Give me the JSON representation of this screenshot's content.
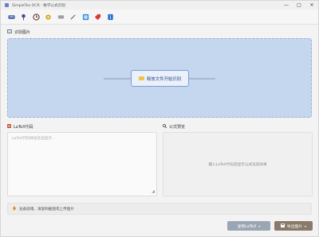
{
  "window": {
    "title": "SimpleTex OCR - 数学公式识别",
    "controls": {
      "minimize": "—",
      "maximize": "□",
      "close": "✕"
    }
  },
  "toolbar": {
    "tools": [
      {
        "icon": "keyboard-icon",
        "color": "#3b5aa8"
      },
      {
        "icon": "pin-icon",
        "color": "#4a4a8a"
      },
      {
        "icon": "history-icon",
        "color": "#6a3b3b"
      },
      {
        "icon": "settings-icon",
        "color": "#e0a32b"
      },
      {
        "icon": "text-icon",
        "color": "#555555"
      },
      {
        "icon": "pen-icon",
        "color": "#777777"
      },
      {
        "icon": "image-icon",
        "color": "#2b8ad8"
      },
      {
        "icon": "tag-icon",
        "color": "#d83b3b"
      },
      {
        "icon": "info-icon",
        "color": "#2b6ad8"
      }
    ]
  },
  "image_panel": {
    "label": "识别图片",
    "drop_button": "释放文件开始识别"
  },
  "latex_panel": {
    "label": "LaTeX代码",
    "placeholder": "LaTeX代码将会在此显示..."
  },
  "preview_panel": {
    "label": "公式预览",
    "placeholder": "输入LaTeX代码后显示公式渲染效果"
  },
  "status": {
    "text": "准备就绪，请复制截图或上传图片"
  },
  "buttons": {
    "copy_latex": "复制LaTeX",
    "export_image": "导出图片"
  },
  "colors": {
    "dropzone": "#c5d6ef",
    "accent": "#2b4a86"
  }
}
